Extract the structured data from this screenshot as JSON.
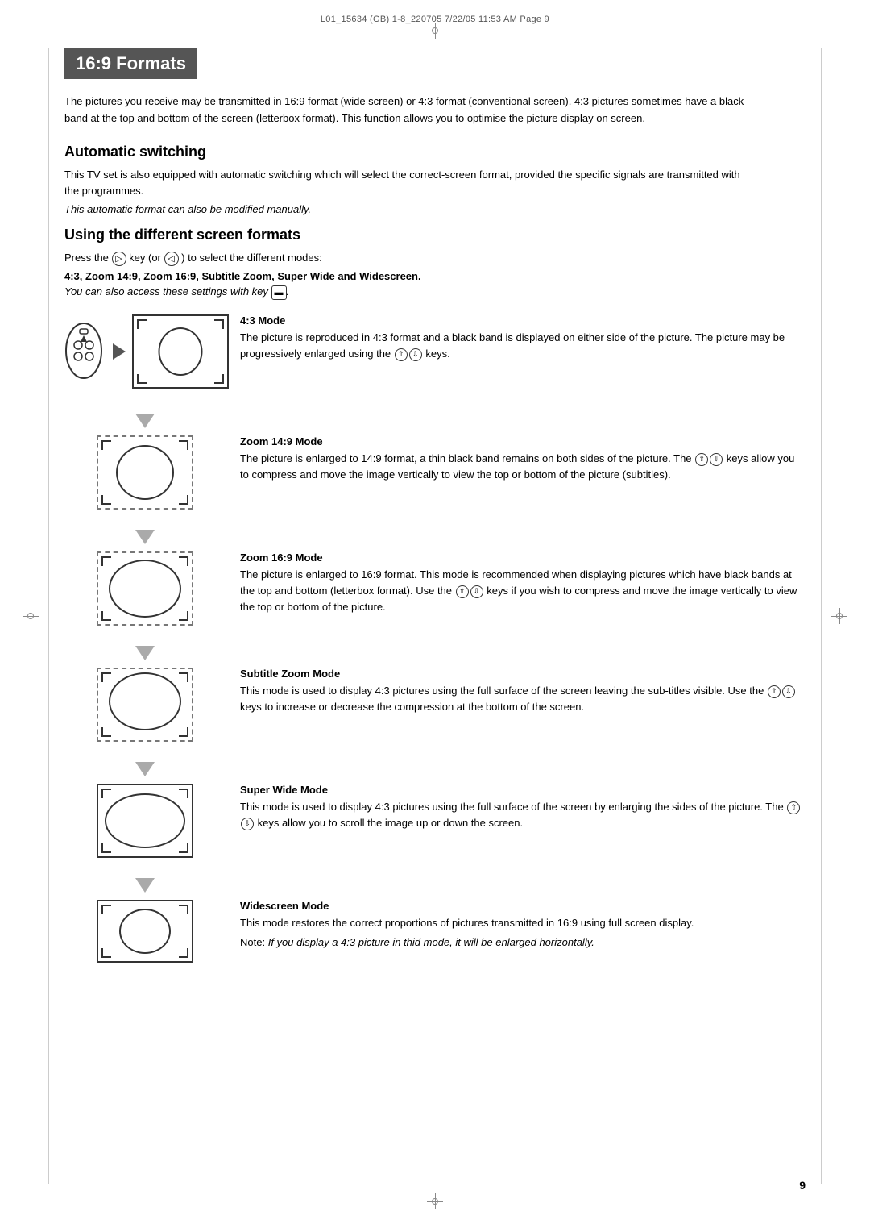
{
  "header": {
    "file_info": "L01_15634 (GB) 1-8_220705  7/22/05  11:53 AM  Page 9"
  },
  "section": {
    "title": "16:9 Formats",
    "intro": "The pictures you receive may be transmitted in 16:9 format (wide screen) or 4:3 format (conventional screen). 4:3 pictures sometimes have a black band at the top and bottom of the screen (letterbox format). This function allows you to optimise the picture display on screen.",
    "automatic_switching": {
      "title": "Automatic switching",
      "body": "This TV set is also equipped with automatic switching which will select the correct-screen format, provided the specific signals are transmitted with the programmes.",
      "italic": "This automatic format can also be modified manually."
    },
    "using_formats": {
      "title": "Using the different screen formats",
      "press_text": "Press the",
      "key1": "D",
      "key1_alt": "◁",
      "select_text": "key (or",
      "key2": "◁",
      "modes_text": ") to select the different modes:",
      "bold_modes": "4:3, Zoom 14:9, Zoom 16:9, Subtitle Zoom, Super Wide",
      "and_text": "and",
      "widescreen": "Widescreen",
      "key_note": "You can also access these settings with key"
    },
    "modes": [
      {
        "id": "mode-43",
        "title": "4:3 Mode",
        "body": "The picture is reproduced in 4:3 format and a black band is displayed on either side of the picture. The picture may be progressively enlarged using the",
        "body2": "keys.",
        "illustration_type": "solid_with_oval_small"
      },
      {
        "id": "mode-zoom149",
        "title": "Zoom 14:9 Mode",
        "body": "The picture is enlarged to 14:9 format, a thin black band remains on both sides of the picture. The",
        "body2": "keys allow you to compress and move the image vertically to view the top or bottom of the picture (subtitles).",
        "illustration_type": "dotted_with_oval_medium"
      },
      {
        "id": "mode-zoom169",
        "title": "Zoom 16:9 Mode",
        "body": "The picture is enlarged to 16:9 format. This mode is recommended when displaying pictures which have black bands at the top and bottom (letterbox format). Use the",
        "body2": "keys if you wish to compress and move the image vertically to view the top or bottom of the picture.",
        "illustration_type": "dotted_with_oval_large"
      },
      {
        "id": "mode-subtitle",
        "title": "Subtitle Zoom Mode",
        "body": "This mode is used to display 4:3 pictures using the full surface of the screen leaving the sub-titles visible. Use the",
        "body2": "keys to increase or decrease the compression at the bottom of the screen.",
        "illustration_type": "dotted_with_oval_subtitle"
      },
      {
        "id": "mode-superwide",
        "title": "Super Wide Mode",
        "body": "This mode is used to display 4:3 pictures using the full surface of the screen by enlarging the sides of the picture. The",
        "body2": "keys allow you to scroll the image up or down the screen.",
        "illustration_type": "solid_with_corners"
      },
      {
        "id": "mode-widescreen",
        "title": "Widescreen Mode",
        "body": "This mode restores the correct proportions of pictures transmitted in 16:9 using full screen display.",
        "body2": "",
        "note": "Note: If you display a 4:3 picture in thid mode, it will be enlarged horizontally.",
        "illustration_type": "solid_wide_oval"
      }
    ]
  },
  "page_number": "9"
}
